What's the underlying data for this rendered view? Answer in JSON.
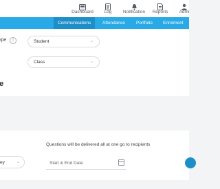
{
  "topnav": [
    {
      "label": "Dashboard",
      "icon": "dashboard-icon"
    },
    {
      "label": "Log",
      "icon": "log-icon"
    },
    {
      "label": "Notification",
      "icon": "bell-icon"
    },
    {
      "label": "Reports",
      "icon": "reports-icon"
    },
    {
      "label": "Admi",
      "icon": "admin-icon"
    }
  ],
  "tabs": [
    {
      "label": "Communications",
      "active": true
    },
    {
      "label": "Attendance"
    },
    {
      "label": "Portfolio"
    },
    {
      "label": "Enrolment"
    }
  ],
  "form": {
    "type_label": "ype",
    "type_value": "Student",
    "class_value": "Class",
    "info_glyph": "i"
  },
  "section": {
    "title": "e"
  },
  "schedule": {
    "note": "Questions will be delivered all at one go to recipients",
    "date_placeholder": "Start & End Date",
    "partial_select_value": "ey"
  },
  "colors": {
    "accent": "#29a9e6",
    "accent_dark": "#1c8ec8"
  }
}
